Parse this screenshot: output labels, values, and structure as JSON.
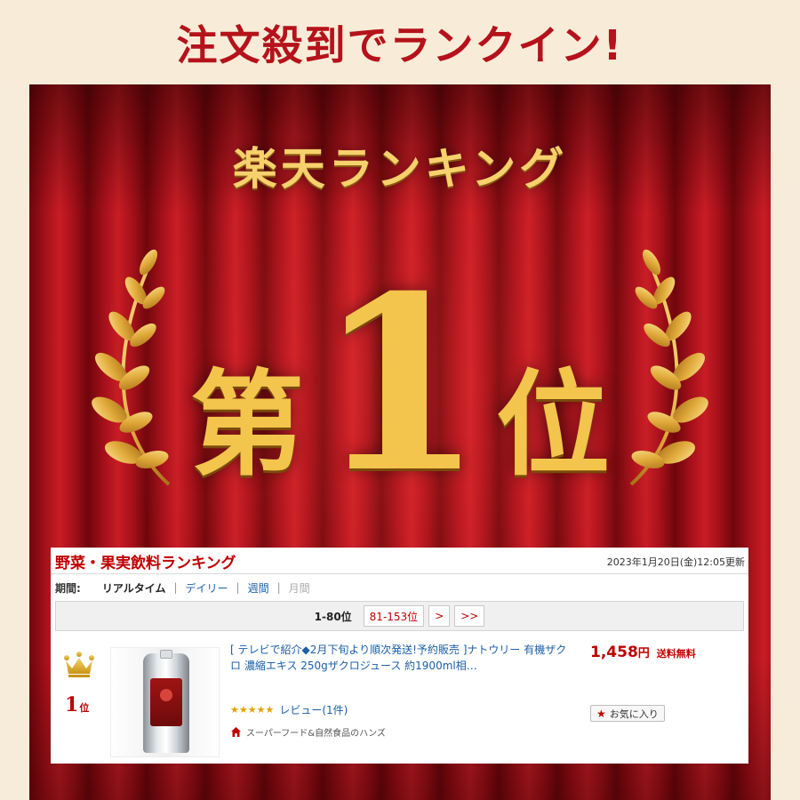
{
  "banner": {
    "headline": "注文殺到でランクイン!"
  },
  "hero": {
    "title": "楽天ランキング",
    "rank_prefix": "第",
    "rank_number": "1",
    "rank_suffix": "位"
  },
  "ranking_card": {
    "title": "野菜・果実飲料ランキング",
    "updated": "2023年1月20日(金)12:05更新",
    "period": {
      "label": "期間:",
      "options": [
        "リアルタイム",
        "デイリー",
        "週間",
        "月間"
      ],
      "selected": "リアルタイム",
      "separator": "|"
    },
    "pager": {
      "current": "1-80位",
      "next_range": "81-153位",
      "next": ">",
      "last": ">>"
    },
    "item": {
      "rank_number": "1",
      "rank_suffix": "位",
      "title": "[ テレビで紹介◆2月下旬より順次発送!予約販売 ]ナトウリー 有機ザクロ 濃縮エキス 250gザクロジュース 約1900ml相…",
      "rating_stars": "★★★★★",
      "review_text": "レビュー(1件)",
      "shop_name": "スーパーフード&自然食品のハンズ",
      "price": "1,458",
      "price_unit": "円",
      "shipping": "送料無料",
      "favorite_label": "お気に入り",
      "icons": {
        "crown": "crown-icon",
        "shop": "house-icon",
        "favorite": "star-icon"
      }
    }
  },
  "colors": {
    "brand_red": "#bf0000",
    "gold": "#f3c54c",
    "link_blue": "#1b5fa8"
  }
}
